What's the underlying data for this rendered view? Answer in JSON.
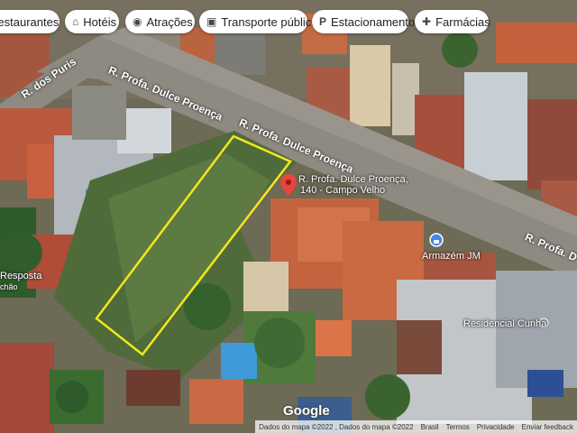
{
  "chips": [
    {
      "label": "Restaurantes",
      "icon": "restaurant-icon"
    },
    {
      "label": "Hotéis",
      "icon": "hotel-icon"
    },
    {
      "label": "Atrações",
      "icon": "camera-icon"
    },
    {
      "label": "Transporte público",
      "icon": "transit-icon"
    },
    {
      "label": "Estacionamento",
      "icon": "parking-icon"
    },
    {
      "label": "Farmácias",
      "icon": "pharmacy-icon"
    }
  ],
  "map": {
    "road_labels": {
      "puris": "R. dos Puris",
      "dulce_1": "R. Profa. Dulce Proença",
      "dulce_2": "R. Profa. Dulce Proença",
      "dulce_3": "R. Profa. D"
    },
    "pin": {
      "title": "R. Profa. Dulce Proença,",
      "subtitle": "140 - Campo Velho",
      "icon": "red-pin-icon"
    },
    "places": {
      "armazem": "Armazém JM",
      "residencial": "Residencial Cunha",
      "resposta": "Resposta",
      "chao": "chão"
    },
    "colors": {
      "highlight": "#f5e71c",
      "pin": "#e8453c",
      "place_icon": "#4285f4"
    }
  },
  "footer": {
    "logo": "Google",
    "data_credit": "Dados do mapa ©2022 , Dados do mapa ©2022",
    "country": "Brasil",
    "terms": "Termos",
    "privacy": "Privacidade",
    "feedback": "Enviar feedback"
  }
}
